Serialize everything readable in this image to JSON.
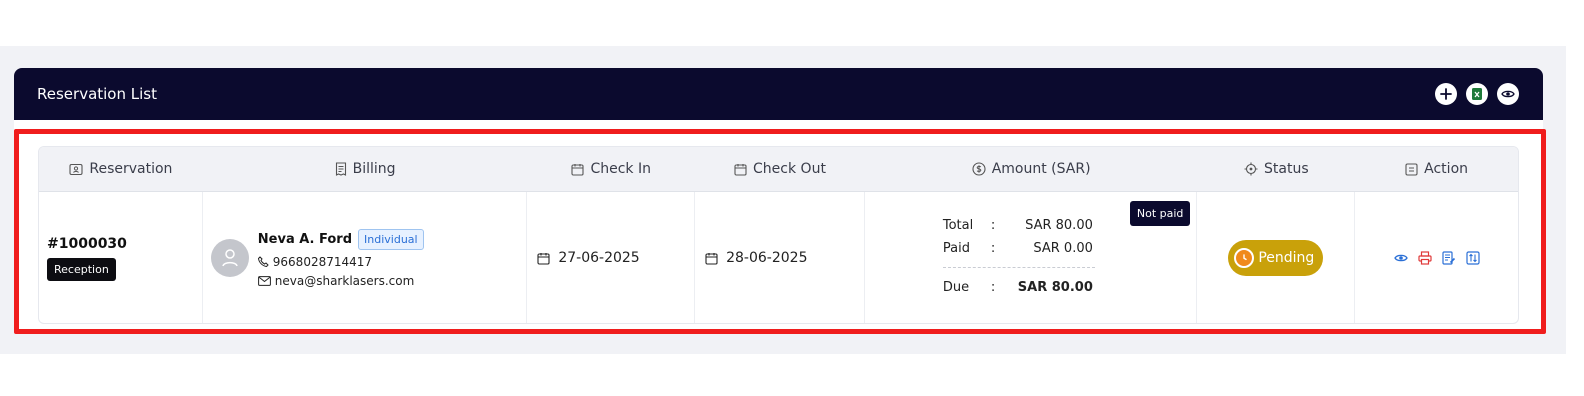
{
  "card": {
    "title": "Reservation List"
  },
  "header_actions": [
    {
      "icon": "plus-icon"
    },
    {
      "icon": "excel-icon"
    },
    {
      "icon": "eye-icon"
    }
  ],
  "table": {
    "headers": {
      "reservation": "Reservation",
      "billing": "Billing",
      "check_in": "Check In",
      "check_out": "Check Out",
      "amount": "Amount (SAR)",
      "status": "Status",
      "action": "Action"
    },
    "row": {
      "reservation_id": "#1000030",
      "source": "Reception",
      "guest_name": "Neva A. Ford",
      "guest_type": "Individual",
      "phone": "9668028714417",
      "email": "neva@sharklasers.com",
      "check_in": "27-06-2025",
      "check_out": "28-06-2025",
      "payment_state": "Not paid",
      "total_label": "Total",
      "total_value": "SAR 80.00",
      "paid_label": "Paid",
      "paid_value": "SAR 0.00",
      "due_label": "Due",
      "due_value": "SAR 80.00",
      "sep": ":",
      "status": "Pending"
    }
  },
  "colors": {
    "header_bg": "#0b0a2e",
    "highlight": "#f01d1d",
    "pending": "#c9a10a",
    "view_icon": "#2a6fd6",
    "print_icon": "#e03a3a"
  }
}
